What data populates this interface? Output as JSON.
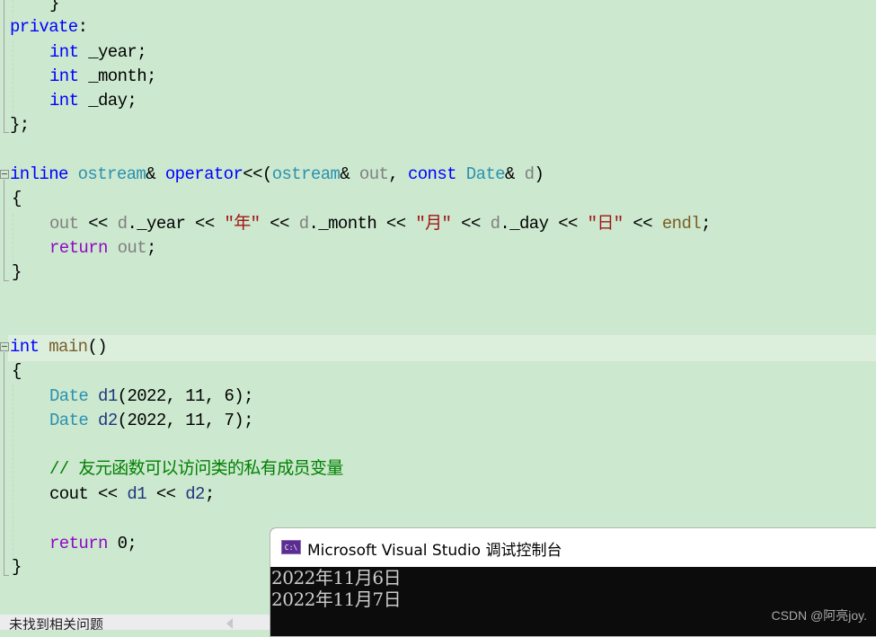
{
  "editor": {
    "lines": {
      "l0": "}",
      "l1_kw": "private",
      "l1_p": ":",
      "l2_kw": "int",
      "l2_v": " _year;",
      "l3_kw": "int",
      "l3_v": " _month;",
      "l4_kw": "int",
      "l4_v": " _day;",
      "l5": "};",
      "l6_inline": "inline",
      "l6_ostream": "ostream",
      "l6_amp": "& ",
      "l6_op": "operator",
      "l6_lt": "<<(",
      "l6_ostream2": "ostream",
      "l6_amp2": "& ",
      "l6_out": "out",
      "l6_comma": ", ",
      "l6_const": "const",
      "l6_sp": " ",
      "l6_date": "Date",
      "l6_amp3": "& ",
      "l6_d": "d",
      "l6_close": ")",
      "l7": "{",
      "l8_out": "out",
      "l8_a": " << ",
      "l8_d1": "d",
      "l8_b": "._year << ",
      "l8_s1": "\"年\"",
      "l8_c": " << ",
      "l8_d2": "d",
      "l8_e": "._month << ",
      "l8_s2": "\"月\"",
      "l8_f": " << ",
      "l8_d3": "d",
      "l8_g": "._day << ",
      "l8_s3": "\"日\"",
      "l8_h": " << ",
      "l8_endl": "endl",
      "l8_semi": ";",
      "l9_ret": "return",
      "l9_sp": " ",
      "l9_out": "out",
      "l9_semi": ";",
      "l10": "}",
      "l11_int": "int",
      "l11_sp": " ",
      "l11_main": "main",
      "l11_paren": "()",
      "l12": "{",
      "l13_type": "Date",
      "l13_sp": " ",
      "l13_var": "d1",
      "l13_args": "(2022, 11, 6);",
      "l14_type": "Date",
      "l14_sp": " ",
      "l14_var": "d2",
      "l14_args": "(2022, 11, 7);",
      "l15_comment": "// 友元函数可以访问类的私有成员变量",
      "l16_cout": "cout << ",
      "l16_d1": "d1",
      "l16_mid": " << ",
      "l16_d2": "d2",
      "l16_semi": ";",
      "l17_ret": "return",
      "l17_rest": " 0;",
      "l18": "}"
    }
  },
  "status_bar": {
    "message": "未找到相关问题"
  },
  "console": {
    "icon_label": "C:\\",
    "title": "Microsoft Visual Studio 调试控制台",
    "output": [
      "2022年11月6日",
      "2022年11月7日"
    ]
  },
  "watermark": "CSDN @阿亮joy."
}
